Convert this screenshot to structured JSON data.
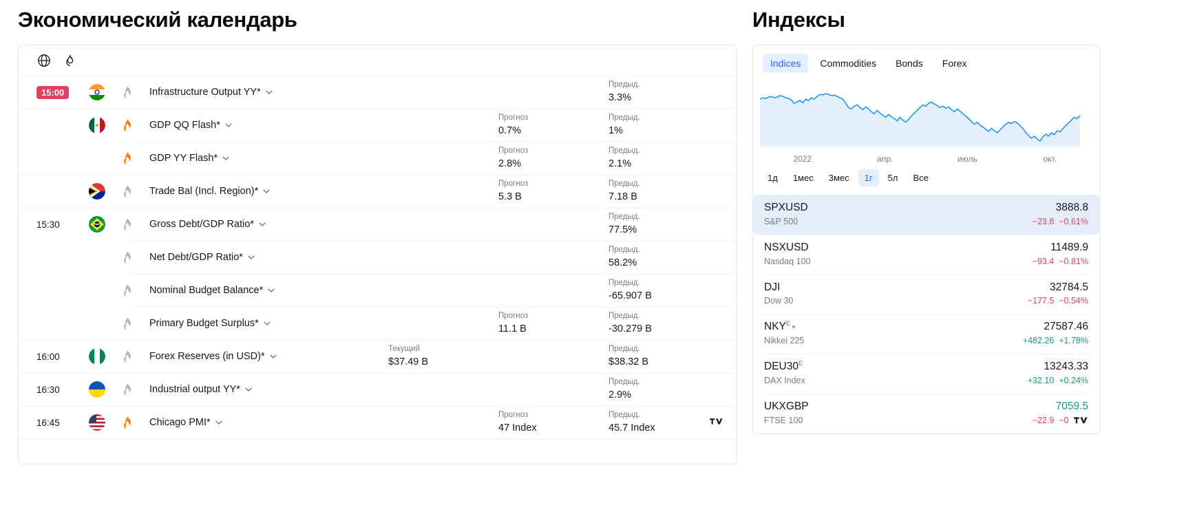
{
  "calendar": {
    "title": "Экономический календарь",
    "toolbar": [
      {
        "name": "globe-icon",
        "label": "globe"
      },
      {
        "name": "flame-icon",
        "label": "flame"
      }
    ],
    "labels": {
      "forecast": "Прогноз",
      "previous": "Предыд.",
      "actual": "Текущий"
    },
    "rows": [
      {
        "time": "15:00",
        "time_highlight": true,
        "flag": "india",
        "vol": "low",
        "event": "Infrastructure Output YY*",
        "forecast_label": "",
        "forecast": "",
        "actual_label": "",
        "actual": "",
        "previous_label": "Предыд.",
        "previous": "3.3%",
        "group_start": true
      },
      {
        "time": "",
        "time_highlight": false,
        "flag": "mexico",
        "vol": "high",
        "event": "GDP QQ Flash*",
        "forecast_label": "Прогноз",
        "forecast": "0.7%",
        "actual_label": "",
        "actual": "",
        "previous_label": "Предыд.",
        "previous": "1%",
        "group_start": true
      },
      {
        "time": "",
        "time_highlight": false,
        "flag": "",
        "vol": "high",
        "event": "GDP YY Flash*",
        "forecast_label": "Прогноз",
        "forecast": "2.8%",
        "actual_label": "",
        "actual": "",
        "previous_label": "Предыд.",
        "previous": "2.1%",
        "group_start": false
      },
      {
        "time": "",
        "time_highlight": false,
        "flag": "southafrica",
        "vol": "low",
        "event": "Trade Bal (Incl. Region)*",
        "forecast_label": "Прогноз",
        "forecast": "5.3 B",
        "actual_label": "",
        "actual": "",
        "previous_label": "Предыд.",
        "previous": "7.18 B",
        "group_start": true
      },
      {
        "time": "15:30",
        "time_highlight": false,
        "flag": "brazil",
        "vol": "low",
        "event": "Gross Debt/GDP Ratio*",
        "forecast_label": "",
        "forecast": "",
        "actual_label": "",
        "actual": "",
        "previous_label": "Предыд.",
        "previous": "77.5%",
        "group_start": true
      },
      {
        "time": "",
        "time_highlight": false,
        "flag": "",
        "vol": "low",
        "event": "Net Debt/GDP Ratio*",
        "forecast_label": "",
        "forecast": "",
        "actual_label": "",
        "actual": "",
        "previous_label": "Предыд.",
        "previous": "58.2%",
        "group_start": false
      },
      {
        "time": "",
        "time_highlight": false,
        "flag": "",
        "vol": "low",
        "event": "Nominal Budget Balance*",
        "forecast_label": "",
        "forecast": "",
        "actual_label": "",
        "actual": "",
        "previous_label": "Предыд.",
        "previous": "-65.907 B",
        "group_start": false
      },
      {
        "time": "",
        "time_highlight": false,
        "flag": "",
        "vol": "low",
        "event": "Primary Budget Surplus*",
        "forecast_label": "Прогноз",
        "forecast": "11.1 B",
        "actual_label": "",
        "actual": "",
        "previous_label": "Предыд.",
        "previous": "-30.279 B",
        "group_start": false
      },
      {
        "time": "16:00",
        "time_highlight": false,
        "flag": "nigeria",
        "vol": "low",
        "event": "Forex Reserves (in USD)*",
        "forecast_label": "",
        "forecast": "",
        "actual_label": "Текущий",
        "actual": "$37.49 B",
        "previous_label": "Предыд.",
        "previous": "$38.32 B",
        "group_start": true
      },
      {
        "time": "16:30",
        "time_highlight": false,
        "flag": "ukraine",
        "vol": "low",
        "event": "Industrial output YY*",
        "forecast_label": "",
        "forecast": "",
        "actual_label": "",
        "actual": "",
        "previous_label": "Предыд.",
        "previous": "2.9%",
        "group_start": true
      },
      {
        "time": "16:45",
        "time_highlight": false,
        "flag": "usa",
        "vol": "high",
        "event": "Chicago PMI*",
        "forecast_label": "Прогноз",
        "forecast": "47 Index",
        "actual_label": "",
        "actual": "",
        "previous_label": "Предыд.",
        "previous": "45.7 Index",
        "group_start": true
      }
    ]
  },
  "indices": {
    "title": "Индексы",
    "tabs": [
      {
        "label": "Indices",
        "active": true
      },
      {
        "label": "Commodities",
        "active": false
      },
      {
        "label": "Bonds",
        "active": false
      },
      {
        "label": "Forex",
        "active": false
      }
    ],
    "ranges": [
      {
        "label": "1д",
        "active": false
      },
      {
        "label": "1мес",
        "active": false
      },
      {
        "label": "3мес",
        "active": false
      },
      {
        "label": "1г",
        "active": true
      },
      {
        "label": "5л",
        "active": false
      },
      {
        "label": "Все",
        "active": false
      }
    ],
    "rows": [
      {
        "symbol": "SPXUSD",
        "sup": "",
        "dot": false,
        "desc": "S&P 500",
        "price": "3888.8",
        "price_dir": "neutral",
        "change": "−23.8",
        "percent": "−0.61%",
        "dir": "neg",
        "selected": true
      },
      {
        "symbol": "NSXUSD",
        "sup": "",
        "dot": false,
        "desc": "Nasdaq 100",
        "price": "11489.9",
        "price_dir": "neutral",
        "change": "−93.4",
        "percent": "−0.81%",
        "dir": "neg",
        "selected": false
      },
      {
        "symbol": "DJI",
        "sup": "",
        "dot": false,
        "desc": "Dow 30",
        "price": "32784.5",
        "price_dir": "neutral",
        "change": "−177.5",
        "percent": "−0.54%",
        "dir": "neg",
        "selected": false
      },
      {
        "symbol": "NKY",
        "sup": "E",
        "dot": true,
        "desc": "Nikkei 225",
        "price": "27587.46",
        "price_dir": "neutral",
        "change": "+482.26",
        "percent": "+1.78%",
        "dir": "pos",
        "selected": false
      },
      {
        "symbol": "DEU30",
        "sup": "E",
        "dot": false,
        "desc": "DAX Index",
        "price": "13243.33",
        "price_dir": "neutral",
        "change": "+32.10",
        "percent": "+0.24%",
        "dir": "pos",
        "selected": false
      },
      {
        "symbol": "UKXGBP",
        "sup": "",
        "dot": false,
        "desc": "FTSE 100",
        "price": "7059.5",
        "price_dir": "up",
        "change": "−22.9",
        "percent": "−0.32%",
        "dir": "neg",
        "selected": false
      }
    ]
  },
  "chart_data": {
    "type": "area",
    "title": "",
    "xlabel": "",
    "ylabel": "",
    "tick_labels": [
      "2022",
      "апр.",
      "июль",
      "окт."
    ],
    "line_color": "#2196f3",
    "fill_color": "#e3f0fb",
    "grid": false,
    "legend": "none",
    "y": [
      78,
      80,
      79,
      81,
      82,
      80,
      81,
      83,
      82,
      80,
      79,
      77,
      72,
      74,
      76,
      73,
      78,
      76,
      80,
      78,
      82,
      85,
      84,
      86,
      85,
      83,
      84,
      82,
      80,
      78,
      72,
      66,
      64,
      68,
      70,
      66,
      63,
      67,
      64,
      60,
      57,
      62,
      58,
      55,
      52,
      56,
      53,
      50,
      47,
      52,
      48,
      45,
      49,
      54,
      58,
      62,
      66,
      70,
      68,
      72,
      74,
      71,
      69,
      66,
      68,
      65,
      67,
      63,
      60,
      64,
      61,
      57,
      54,
      50,
      46,
      42,
      45,
      41,
      38,
      35,
      32,
      36,
      33,
      30,
      34,
      38,
      42,
      45,
      43,
      46,
      44,
      40,
      36,
      30,
      26,
      22,
      25,
      21,
      18,
      24,
      28,
      25,
      30,
      27,
      33,
      31,
      36,
      40,
      44,
      48,
      52,
      50,
      55
    ]
  }
}
